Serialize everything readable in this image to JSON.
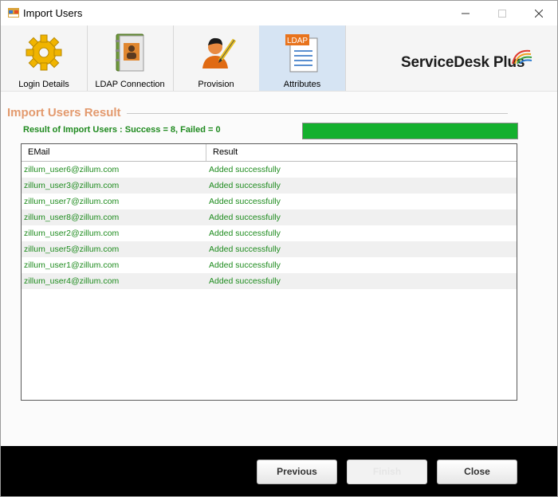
{
  "window": {
    "title": "Import Users"
  },
  "toolbar": {
    "tabs": [
      {
        "label": "Login Details",
        "icon": "gear-icon",
        "active": false
      },
      {
        "label": "LDAP Connection",
        "icon": "address-book-icon",
        "active": false
      },
      {
        "label": "Provision",
        "icon": "user-pen-icon",
        "active": false
      },
      {
        "label": "Attributes",
        "icon": "ldap-document-icon",
        "active": true
      }
    ],
    "ldap_badge": "LDAP"
  },
  "brand": {
    "name": "ServiceDesk Plus"
  },
  "section": {
    "title": "Import Users Result",
    "result": "Result of Import Users : Success = 8, Failed = 0",
    "progress_percent": 100
  },
  "table": {
    "columns": [
      "EMail",
      "Result"
    ],
    "rows": [
      {
        "email": "zillum_user6@zillum.com",
        "result": "Added successfully"
      },
      {
        "email": "zillum_user3@zillum.com",
        "result": "Added successfully"
      },
      {
        "email": "zillum_user7@zillum.com",
        "result": "Added successfully"
      },
      {
        "email": "zillum_user8@zillum.com",
        "result": "Added successfully"
      },
      {
        "email": "zillum_user2@zillum.com",
        "result": "Added successfully"
      },
      {
        "email": "zillum_user5@zillum.com",
        "result": "Added successfully"
      },
      {
        "email": "zillum_user1@zillum.com",
        "result": "Added successfully"
      },
      {
        "email": "zillum_user4@zillum.com",
        "result": "Added successfully"
      }
    ]
  },
  "footer": {
    "previous": "Previous",
    "finish": "Finish",
    "close": "Close"
  },
  "colors": {
    "accent": "#e39a6e",
    "success": "#1f8a1f",
    "progress": "#14b02e",
    "active_tab": "#d6e4f3"
  }
}
